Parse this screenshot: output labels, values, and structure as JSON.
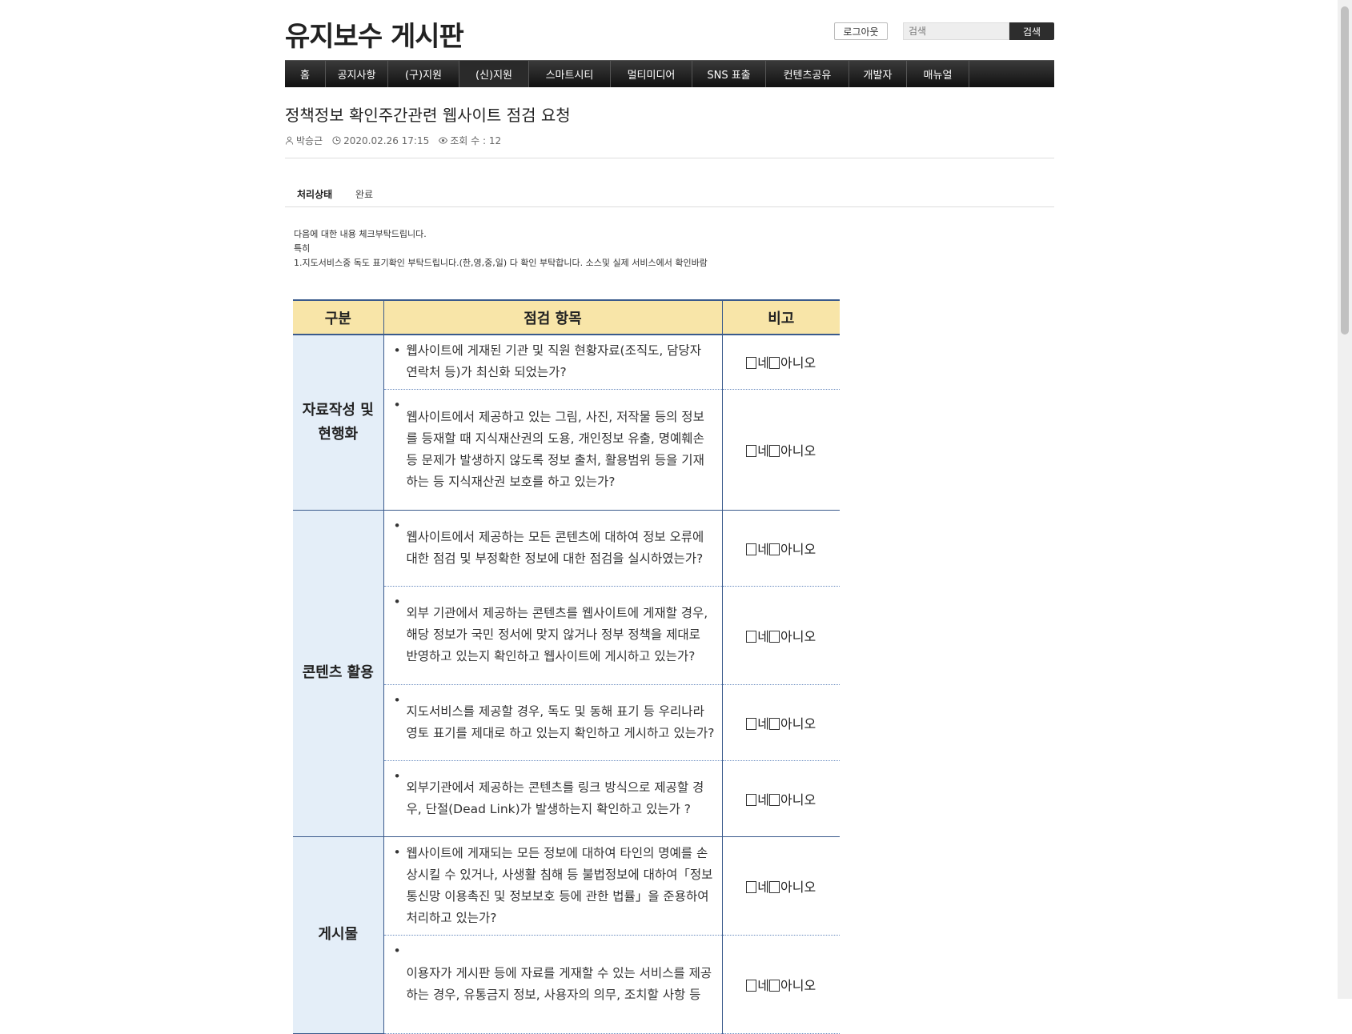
{
  "header": {
    "site_title": "유지보수 게시판",
    "logout_label": "로그아웃",
    "search_placeholder": "검색",
    "search_button": "검색"
  },
  "nav": {
    "items": [
      {
        "label": "홈"
      },
      {
        "label": "공지사항"
      },
      {
        "label": "(구)지원"
      },
      {
        "label": "(신)지원"
      },
      {
        "label": "스마트시티"
      },
      {
        "label": "멀티미디어"
      },
      {
        "label": "SNS 표출"
      },
      {
        "label": "컨텐츠공유"
      },
      {
        "label": "개발자"
      },
      {
        "label": "매뉴얼"
      }
    ]
  },
  "post": {
    "title": "정책정보 확인주간관련 웹사이트 점검 요청",
    "author": "박승근",
    "datetime": "2020.02.26 17:15",
    "views": "조회 수 : 12",
    "status_label": "처리상태",
    "status_value": "완료",
    "body_lines": [
      "다음에 대한 내용 체크부탁드립니다.",
      "특히",
      "1.지도서비스중 독도 표기확인 부탁드립니다.(한,영,중,일) 다 확인 부탁합니다. 소스및 실제 서비스에서 확인바람"
    ]
  },
  "table": {
    "headers": [
      "구분",
      "점검 항목",
      "비고"
    ],
    "option_yes": "네",
    "option_no": "아니오",
    "groups": [
      {
        "category": "자료작성 및 현행화",
        "items": [
          "웹사이트에 게재된 기관 및 직원 현황자료(조직도, 담당자 연락처 등)가 최신화 되었는가?",
          "웹사이트에서 제공하고 있는 그림, 사진, 저작물 등의 정보를 등재할 때 지식재산권의 도용, 개인정보 유출, 명예훼손 등 문제가 발생하지 않도록 정보 출처, 활용범위 등을 기재하는 등 지식재산권 보호를 하고 있는가?"
        ]
      },
      {
        "category": "콘텐츠 활용",
        "items": [
          "웹사이트에서 제공하는 모든 콘텐츠에 대하여 정보 오류에 대한 점검 및 부정확한 정보에 대한 점검을 실시하였는가?",
          "외부 기관에서 제공하는 콘텐츠를 웹사이트에 게재할 경우, 해당 정보가 국민 정서에 맞지 않거나 정부 정책을 제대로 반영하고 있는지 확인하고 웹사이트에 게시하고 있는가?",
          "지도서비스를 제공할 경우, 독도 및 동해 표기 등 우리나라 영토 표기를 제대로 하고 있는지 확인하고 게시하고 있는가?",
          "외부기관에서 제공하는 콘텐츠를 링크 방식으로 제공할 경우, 단절(Dead Link)가 발생하는지 확인하고 있는가 ?"
        ]
      },
      {
        "category": "게시물",
        "items": [
          "웹사이트에 게재되는 모든 정보에 대하여 타인의 명예를 손상시킬 수 있거나, 사생활 침해 등 불법정보에 대하여「정보통신망 이용촉진 및 정보보호 등에 관한 법률」을 준용하여 처리하고 있는가?",
          "이용자가 게시판 등에 자료를 게재할 수 있는 서비스를 제공하는 경우, 유통금지 정보, 사용자의 의무, 조치할 사항 등"
        ]
      }
    ]
  }
}
